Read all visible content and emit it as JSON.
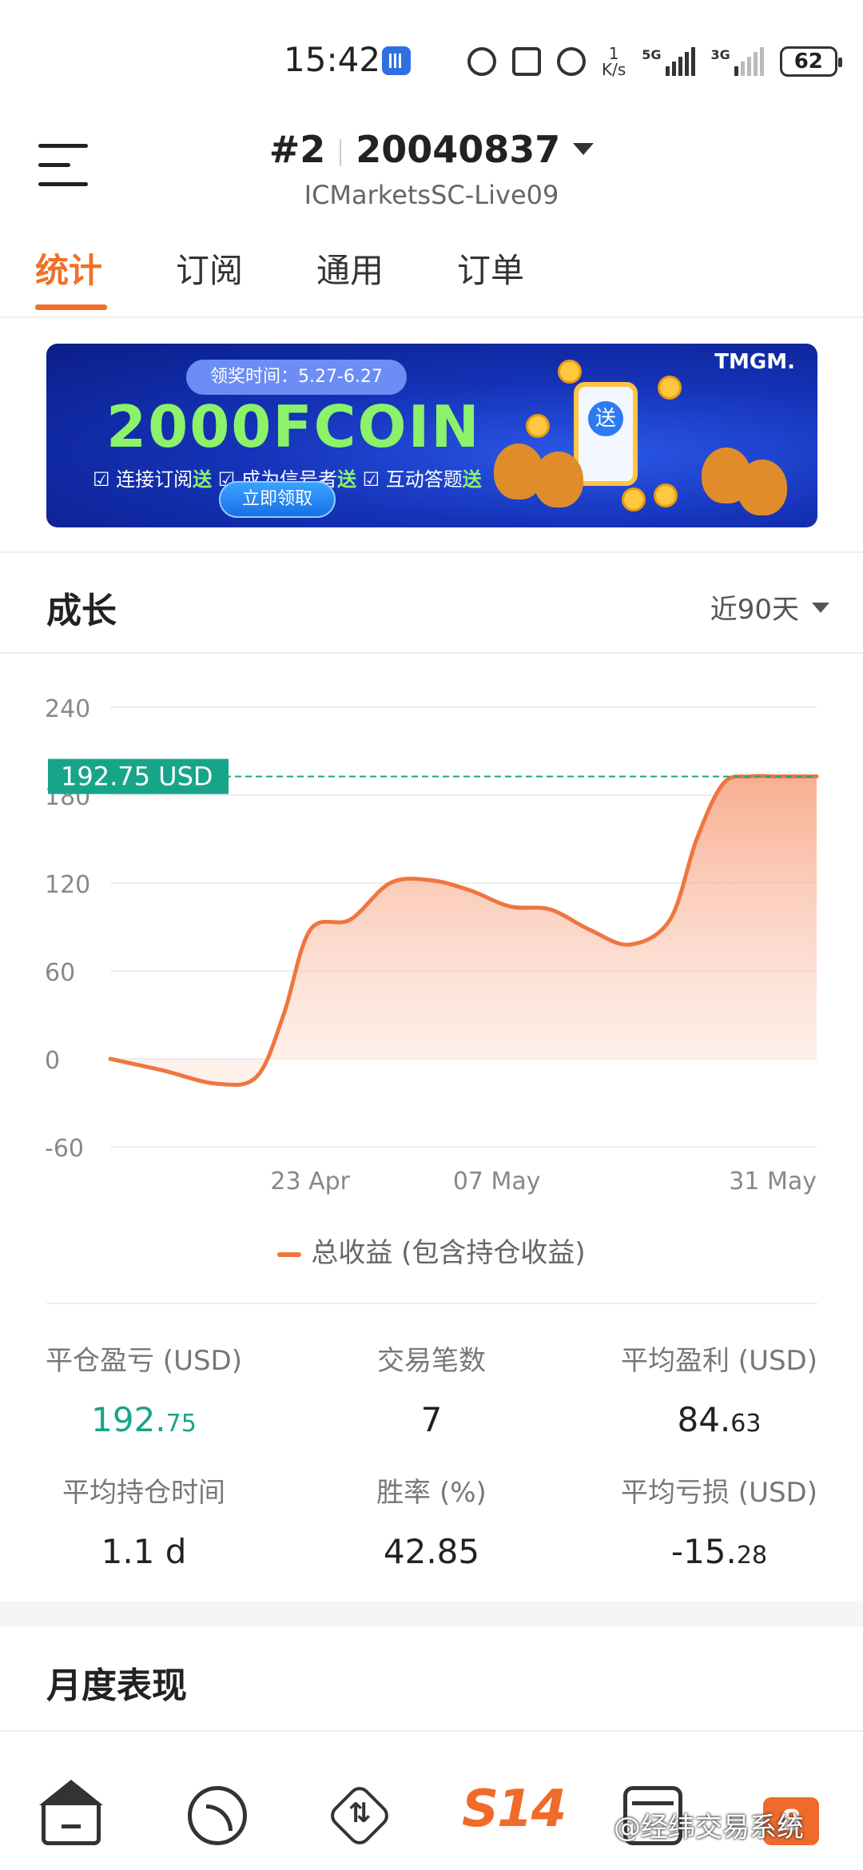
{
  "status_bar": {
    "time": "15:42",
    "net_speed_value": "1",
    "net_speed_unit": "K/s",
    "signal_1_label": "5G",
    "signal_2_label": "3G",
    "battery": "62"
  },
  "header": {
    "account_index": "#2",
    "account_number": "20040837",
    "server": "ICMarketsSC-Live09"
  },
  "tabs": [
    {
      "label": "统计",
      "active": true
    },
    {
      "label": "订阅",
      "active": false
    },
    {
      "label": "通用",
      "active": false
    },
    {
      "label": "订单",
      "active": false
    }
  ],
  "banner": {
    "date": "领奖时间：5.27-6.27",
    "headline": "2000FCOIN",
    "perk_1": "连接订阅",
    "perk_2": "成为信号者",
    "perk_3": "互动答题",
    "gift_word": "送",
    "button": "立即领取",
    "brand": "TMGM."
  },
  "growth": {
    "title": "成长",
    "range": "近90天"
  },
  "chart_data": {
    "type": "area",
    "x": [
      "2024-04-08",
      "2024-04-12",
      "2024-04-16",
      "2024-04-19",
      "2024-04-21",
      "2024-04-23",
      "2024-04-26",
      "2024-04-29",
      "2024-05-02",
      "2024-05-05",
      "2024-05-08",
      "2024-05-11",
      "2024-05-14",
      "2024-05-17",
      "2024-05-20",
      "2024-05-22",
      "2024-05-24",
      "2024-05-26",
      "2024-05-28",
      "2024-05-31"
    ],
    "series": [
      {
        "name": "总收益 (包含持仓收益)",
        "values": [
          0,
          -8,
          -17,
          -12,
          30,
          88,
          95,
          120,
          122,
          115,
          104,
          102,
          88,
          78,
          95,
          150,
          188,
          192.75,
          192.75,
          192.75
        ]
      }
    ],
    "yticks": [
      240,
      180,
      120,
      60,
      0,
      -60
    ],
    "xticks": [
      {
        "label": "23 Apr",
        "date": "2024-04-23"
      },
      {
        "label": "07 May",
        "date": "2024-05-07"
      },
      {
        "label": "31 May",
        "date": "2024-05-31"
      }
    ],
    "ylim": [
      -60,
      240
    ],
    "current_value_label": "192.75 USD",
    "current_value": 192.75,
    "grid": true,
    "line_color": "#ef7640",
    "marker_color": "#17a58a"
  },
  "legend_label": "总收益 (包含持仓收益)",
  "stats": [
    {
      "label": "平仓盈亏 (USD)",
      "int": "192.",
      "dec": "75",
      "green": true
    },
    {
      "label": "交易笔数",
      "int": "7",
      "dec": "",
      "green": false
    },
    {
      "label": "平均盈利 (USD)",
      "int": "84.",
      "dec": "63",
      "green": false
    },
    {
      "label": "平均持仓时间",
      "int": "1.1 d",
      "dec": "",
      "green": false
    },
    {
      "label": "胜率 (%)",
      "int": "42.85",
      "dec": "",
      "green": false
    },
    {
      "label": "平均亏损 (USD)",
      "int": "-15.",
      "dec": "28",
      "green": false
    }
  ],
  "monthly_title": "月度表现",
  "bottom_nav": {
    "rank_label": "S14",
    "badge": "8",
    "watermark": "@经纬交易系统",
    "trade_glyph": "⇅"
  },
  "colors": {
    "accent": "#f07028",
    "positive": "#17a58a",
    "line": "#ef7640"
  }
}
